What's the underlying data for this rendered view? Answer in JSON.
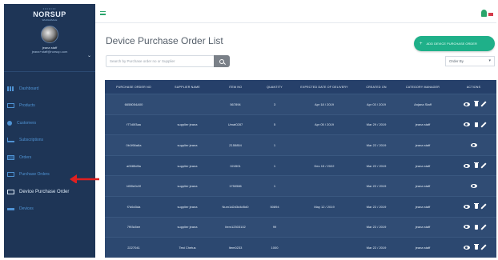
{
  "brand": {
    "dots": "•••••••",
    "name": "NORSUP",
    "tag": "WHOLESALE"
  },
  "user": {
    "name": "jeana staff",
    "email": "jeana+staff@norsup.com"
  },
  "sidebar": {
    "items": [
      {
        "label": "Dashboard",
        "icon": "grid-icon"
      },
      {
        "label": "Products",
        "icon": "box-icon"
      },
      {
        "label": "Customers",
        "icon": "users-icon"
      },
      {
        "label": "Subscriptions",
        "icon": "cart-icon"
      },
      {
        "label": "Orders",
        "icon": "doc-icon"
      },
      {
        "label": "Purchase Orders",
        "icon": "clipboard-icon"
      },
      {
        "label": "Device Purchase Order",
        "icon": "monitor-icon",
        "active": true
      },
      {
        "label": "Devices",
        "icon": "list-icon"
      }
    ]
  },
  "header": {
    "title": "Device Purchase Order List"
  },
  "toolbar": {
    "add_label": "ADD DEVICE PURCHASE ORDER",
    "search_placeholder": "Search by Purchase order no or Supplier",
    "order_by": "Order By"
  },
  "table": {
    "columns": [
      "PURCHASE ORDER NO",
      "SUPPLIER NAME",
      "ITEM NO",
      "QUANTITY",
      "EXPECTED DATE OF DELIVERY",
      "CREATED ON",
      "CATEGORY MANAGER",
      "ACTIONS"
    ],
    "rows": [
      {
        "po": "6658054A00",
        "supplier": "",
        "item": "567894",
        "qty": "3",
        "expected": "Apr 18 / 2019",
        "created": "Apr 03 / 2019",
        "manager": "Anjana Staff",
        "actions": [
          "view",
          "delete",
          "edit"
        ]
      },
      {
        "po": "f77d0f3aa",
        "supplier": "supplier jeana",
        "item": "Umat0287",
        "qty": "5",
        "expected": "Apr 05 / 2019",
        "created": "Mar 29 / 2019",
        "manager": "jeana staff",
        "actions": [
          "view",
          "delete",
          "edit"
        ]
      },
      {
        "po": "0b1f66a6a",
        "supplier": "supplier jeana",
        "item": "Z155854",
        "qty": "1",
        "expected": "",
        "created": "Mar 22 / 2019",
        "manager": "jeana staff",
        "actions": [
          "view"
        ]
      },
      {
        "po": "a0085d9a",
        "supplier": "supplier jeana",
        "item": "024501",
        "qty": "1",
        "expected": "Dec 15 / 2022",
        "created": "Mar 22 / 2019",
        "manager": "jeana staff",
        "actions": [
          "view",
          "delete",
          "edit"
        ]
      },
      {
        "po": "b5f0e0c9f",
        "supplier": "supplier jeana",
        "item": "1750586",
        "qty": "1",
        "expected": "",
        "created": "Mar 22 / 2019",
        "manager": "jeana staff",
        "actions": [
          "view"
        ]
      },
      {
        "po": "f7d6d3da",
        "supplier": "supplier jeana",
        "item": "Num1d2d3d4d5d0",
        "qty": "50894",
        "expected": "May 12 / 2019",
        "created": "Mar 22 / 2019",
        "manager": "jeana staff",
        "actions": [
          "view",
          "delete",
          "edit"
        ]
      },
      {
        "po": "7f93c5ee",
        "supplier": "supplier jeana",
        "item": "Item12303102",
        "qty": "99",
        "expected": "",
        "created": "Mar 22 / 2019",
        "manager": "jeana staff",
        "actions": [
          "view",
          "delete",
          "edit"
        ]
      },
      {
        "po": "2227041",
        "supplier": "Test Chetus",
        "item": "Item0233",
        "qty": "1000",
        "expected": "",
        "created": "Mar 22 / 2019",
        "manager": "jeana staff",
        "actions": [
          "view",
          "delete",
          "edit"
        ]
      }
    ]
  },
  "colors": {
    "sidebar": "#1e3556",
    "accent": "#1fb089",
    "table": "#2c4870",
    "arrow": "#e02020"
  }
}
